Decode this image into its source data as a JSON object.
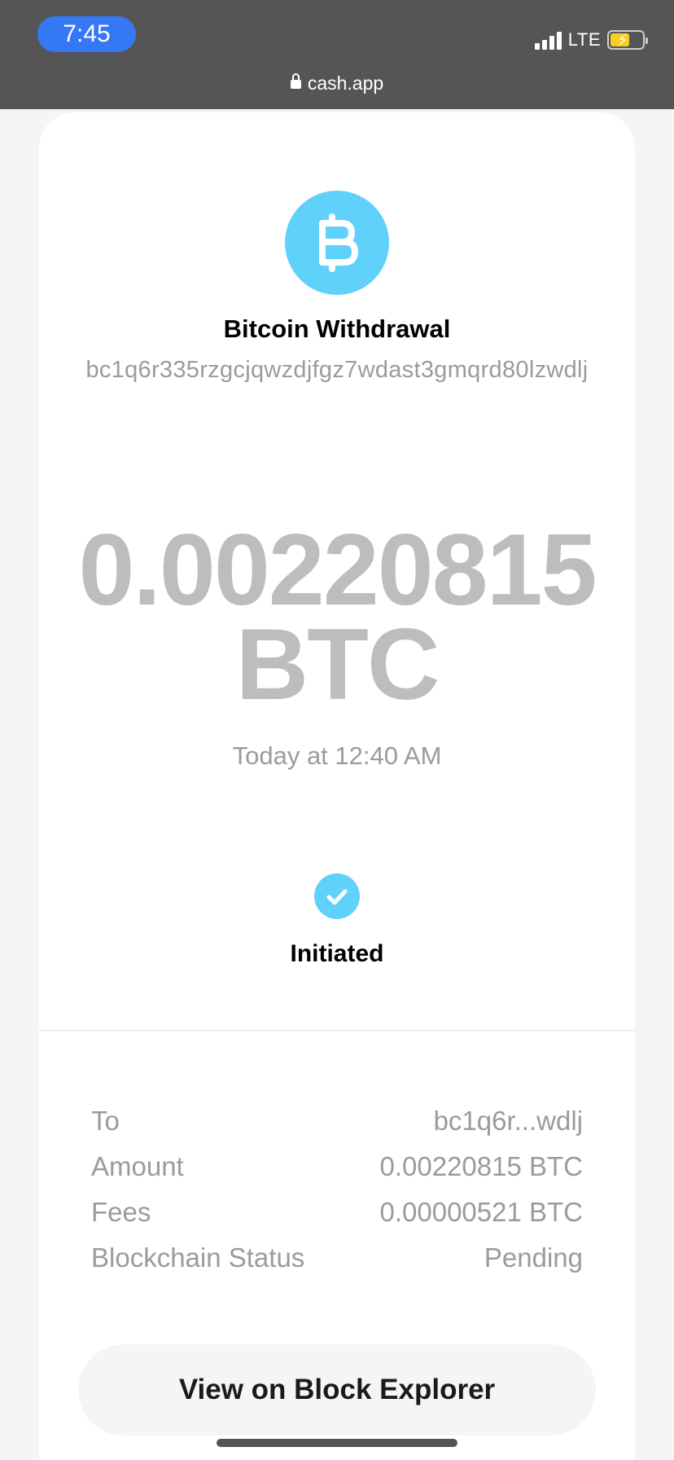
{
  "status_bar": {
    "time": "7:45",
    "network": "LTE",
    "battery_level": 0.6,
    "battery_charging": true
  },
  "url_bar": {
    "url": "cash.app",
    "lock_icon": "lock-icon"
  },
  "transaction": {
    "icon": "bitcoin-icon",
    "title": "Bitcoin Withdrawal",
    "address": "bc1q6r335rzgcjqwzdjfgz7wdast3gmqrd80lzwdlj",
    "amount": "0.00220815",
    "unit": "BTC",
    "timestamp": "Today at 12:40 AM",
    "status_icon": "checkmark-icon",
    "status": "Initiated"
  },
  "details": [
    {
      "label": "To",
      "value": "bc1q6r...wdlj"
    },
    {
      "label": "Amount",
      "value": "0.00220815 BTC"
    },
    {
      "label": "Fees",
      "value": "0.00000521 BTC"
    },
    {
      "label": "Blockchain Status",
      "value": "Pending"
    }
  ],
  "actions": {
    "block_explorer_label": "View on Block Explorer"
  },
  "colors": {
    "accent": "#5fd1fb",
    "status_bar_bg": "#555555",
    "time_pill": "#3478f6",
    "muted_text": "#9b9b9b",
    "amount_text": "#bdbdbd"
  }
}
